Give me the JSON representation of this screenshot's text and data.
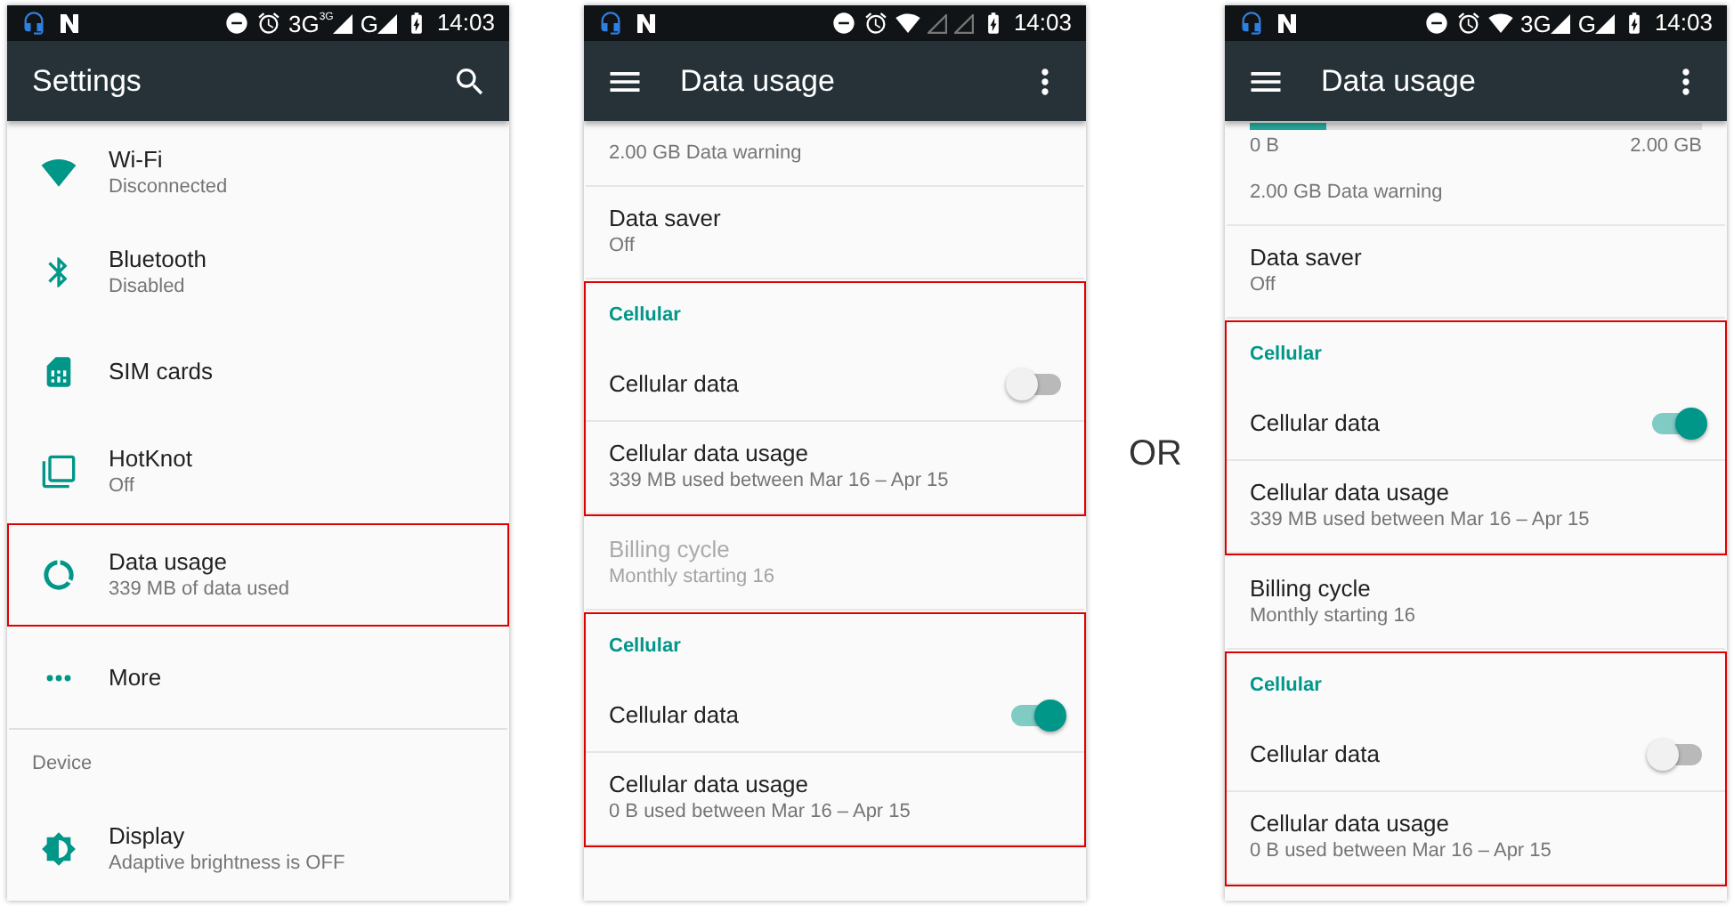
{
  "screens": [
    {
      "status_bar": {
        "wifi": false,
        "network": [
          {
            "label": "3G",
            "sup": "3G",
            "connected": true
          },
          {
            "label": "G",
            "connected": true
          }
        ],
        "time": "14:03"
      },
      "toolbar": {
        "menu_button": false,
        "title": "Settings",
        "search_button": true,
        "more_button": false
      },
      "sections": [
        {
          "highlighted": false,
          "rows": [
            {
              "kind": "item",
              "title": "Wi-Fi",
              "summary": "Disconnected"
            },
            {
              "kind": "item",
              "title": "Bluetooth",
              "summary": "Disabled"
            },
            {
              "kind": "item",
              "title": "SIM cards"
            },
            {
              "kind": "item",
              "title": "HotKnot",
              "summary": "Off"
            }
          ]
        },
        {
          "highlighted": true,
          "rows": [
            {
              "kind": "item",
              "title": "Data usage",
              "summary": "339 MB of data used"
            }
          ]
        },
        {
          "highlighted": false,
          "rows": [
            {
              "kind": "item",
              "title": "More"
            },
            {
              "kind": "header",
              "title": "Device"
            },
            {
              "kind": "item",
              "title": "Display",
              "summary": "Adaptive brightness is OFF"
            }
          ]
        }
      ]
    },
    {
      "status_bar": {
        "wifi": true,
        "network": [
          {
            "connected": false
          },
          {
            "connected": false
          }
        ],
        "time": "14:03"
      },
      "toolbar": {
        "menu_button": true,
        "title": "Data usage",
        "search_button": false,
        "more_button": true
      },
      "sections": [
        {
          "highlighted": false,
          "rows": [
            {
              "kind": "note",
              "title": "2.00 GB Data warning"
            },
            {
              "kind": "pref",
              "title": "Data saver",
              "summary": "Off",
              "disabled": false
            }
          ]
        },
        {
          "highlighted": true,
          "rows": [
            {
              "kind": "category",
              "title": "Cellular"
            },
            {
              "kind": "switch",
              "title": "Cellular data",
              "on": false
            },
            {
              "kind": "pref",
              "title": "Cellular data usage",
              "summary": "339 MB used between Mar 16 – Apr 15",
              "disabled": false
            }
          ]
        },
        {
          "highlighted": false,
          "rows": [
            {
              "kind": "pref",
              "title": "Billing cycle",
              "summary": "Monthly starting 16",
              "disabled": true
            }
          ]
        },
        {
          "highlighted": true,
          "rows": [
            {
              "kind": "category",
              "title": "Cellular"
            },
            {
              "kind": "switch",
              "title": "Cellular data",
              "on": true
            },
            {
              "kind": "pref",
              "title": "Cellular data usage",
              "summary": "0 B used between Mar 16 – Apr 15",
              "disabled": false
            }
          ]
        }
      ]
    },
    {
      "status_bar": {
        "wifi": true,
        "network": [
          {
            "label": "3G",
            "connected": true
          },
          {
            "label": "G",
            "connected": true
          }
        ],
        "time": "14:03"
      },
      "toolbar": {
        "menu_button": true,
        "title": "Data usage",
        "search_button": false,
        "more_button": true
      },
      "sections": [
        {
          "highlighted": false,
          "rows": [
            {
              "kind": "range",
              "level": 0.17,
              "min": "0 B",
              "max": "2.00 GB"
            },
            {
              "kind": "note",
              "title": "2.00 GB Data warning"
            },
            {
              "kind": "pref",
              "title": "Data saver",
              "summary": "Off",
              "disabled": false
            }
          ]
        },
        {
          "highlighted": true,
          "rows": [
            {
              "kind": "category",
              "title": "Cellular"
            },
            {
              "kind": "switch",
              "title": "Cellular data",
              "on": true
            },
            {
              "kind": "pref",
              "title": "Cellular data usage",
              "summary": "339 MB used between Mar 16 – Apr 15",
              "disabled": false
            }
          ]
        },
        {
          "highlighted": false,
          "rows": [
            {
              "kind": "pref",
              "title": "Billing cycle",
              "summary": "Monthly starting 16",
              "disabled": false
            }
          ]
        },
        {
          "highlighted": true,
          "rows": [
            {
              "kind": "category",
              "title": "Cellular"
            },
            {
              "kind": "switch",
              "title": "Cellular data",
              "on": false
            },
            {
              "kind": "pref",
              "title": "Cellular data usage",
              "summary": "0 B used between Mar 16 – Apr 15",
              "disabled": false
            }
          ]
        }
      ]
    }
  ],
  "separator": "OR"
}
